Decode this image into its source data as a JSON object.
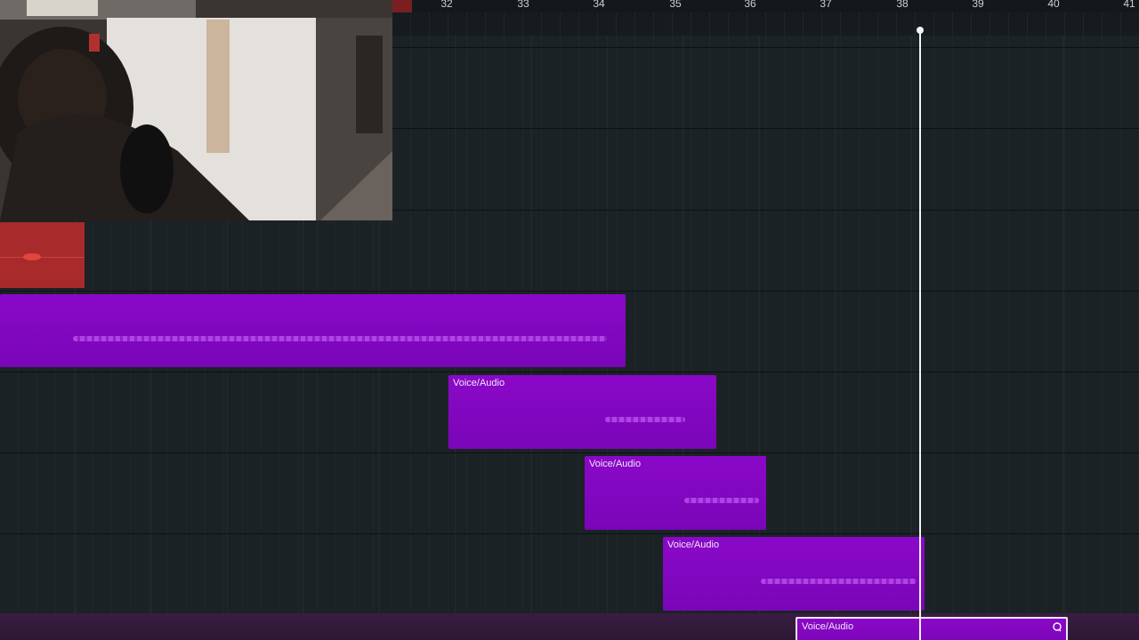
{
  "timeline": {
    "bars": [
      "32",
      "33",
      "34",
      "35",
      "36",
      "37",
      "38",
      "39",
      "40",
      "41"
    ]
  },
  "clips": {
    "clip_1_label": "Voice/Audio",
    "clip_2_label": "Voice/Audio",
    "clip_3_label": "Voice/Audio",
    "clip_4_label": "Voice/Audio"
  },
  "colors": {
    "clip_purple": "#8a08c8",
    "recording_red": "#a82a2a",
    "playhead": "#f2f2f2",
    "background": "#1b2226"
  },
  "icons": {
    "loop": "loop-icon"
  }
}
